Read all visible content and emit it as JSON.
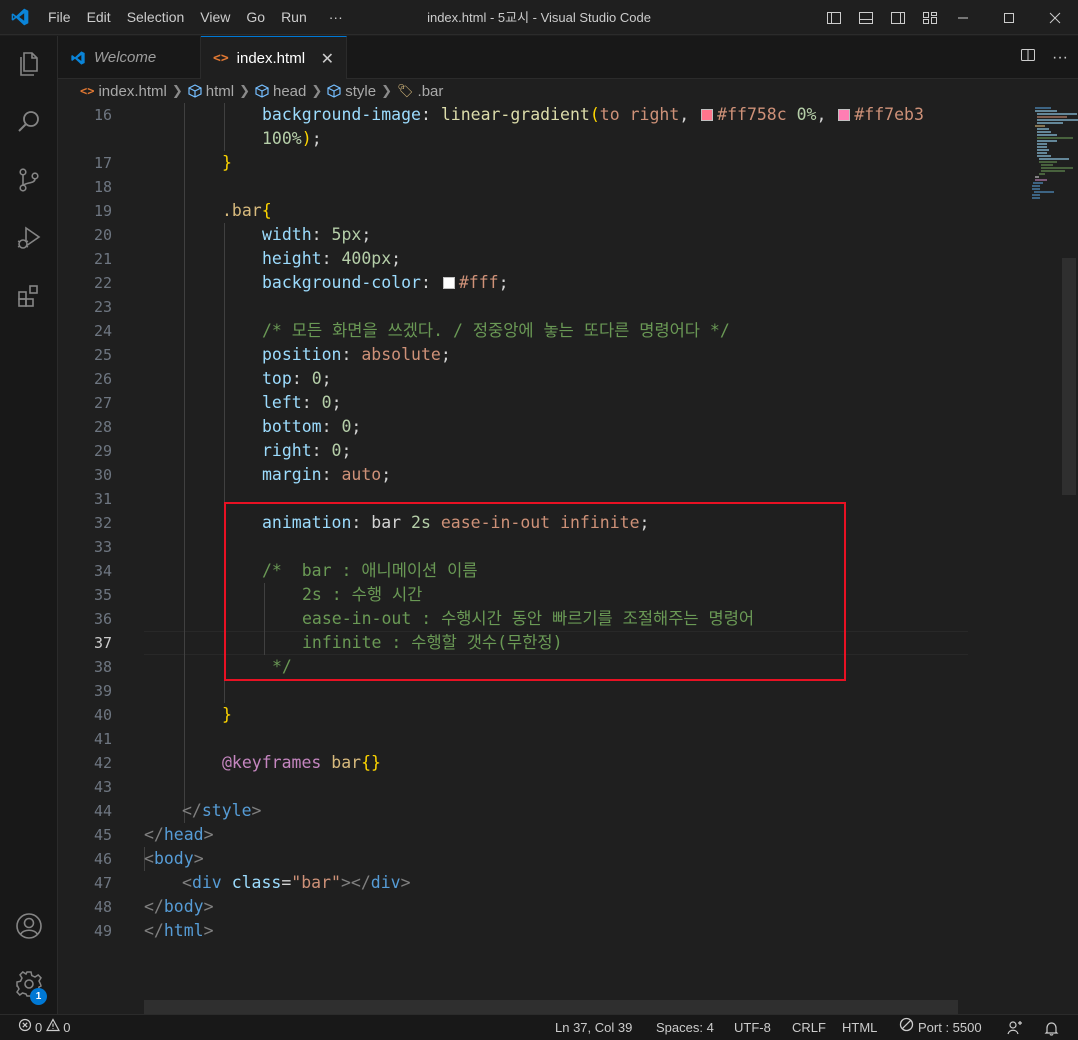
{
  "window": {
    "title": "index.html - 5교시 - Visual Studio Code",
    "menu": [
      "File",
      "Edit",
      "Selection",
      "View",
      "Go",
      "Run",
      "···"
    ]
  },
  "tabs": [
    {
      "label": "Welcome"
    },
    {
      "label": "index.html",
      "close": "✕"
    }
  ],
  "breadcrumb": [
    "index.html",
    "html",
    "head",
    "style",
    ".bar"
  ],
  "colors": {
    "accent": "#0078d4",
    "highlight_box": "#e81123",
    "swatch_1": "#ff758c",
    "swatch_2": "#ff7eb3",
    "swatch_3": "#ffffff"
  },
  "icons": {
    "activity": [
      "explorer-icon",
      "search-icon",
      "source-control-icon",
      "run-debug-icon",
      "extensions-icon",
      "account-icon",
      "settings-gear-icon"
    ],
    "settings_badge": "1"
  },
  "editor": {
    "current_line": "37",
    "lines": [
      {
        "n": "16",
        "t": "background-image: linear-gradient(to right, #ff758c 0%, #ff7eb3"
      },
      {
        "n": "",
        "t": "100%);"
      },
      {
        "n": "17",
        "t": "}"
      },
      {
        "n": "18",
        "t": ""
      },
      {
        "n": "19",
        "t": ".bar{"
      },
      {
        "n": "20",
        "t": "width: 5px;"
      },
      {
        "n": "21",
        "t": "height: 400px;"
      },
      {
        "n": "22",
        "t": "background-color: #fff;"
      },
      {
        "n": "23",
        "t": ""
      },
      {
        "n": "24",
        "t": "/* 모든 화면을 쓰겠다. / 정중앙에 놓는 또다른 명령어다 */"
      },
      {
        "n": "25",
        "t": "position: absolute;"
      },
      {
        "n": "26",
        "t": "top: 0;"
      },
      {
        "n": "27",
        "t": "left: 0;"
      },
      {
        "n": "28",
        "t": "bottom: 0;"
      },
      {
        "n": "29",
        "t": "right: 0;"
      },
      {
        "n": "30",
        "t": "margin: auto;"
      },
      {
        "n": "31",
        "t": ""
      },
      {
        "n": "32",
        "t": "animation: bar 2s ease-in-out infinite;"
      },
      {
        "n": "33",
        "t": ""
      },
      {
        "n": "34",
        "t": "/*  bar : 애니메이션 이름"
      },
      {
        "n": "35",
        "t": "2s : 수행 시간"
      },
      {
        "n": "36",
        "t": "ease-in-out : 수행시간 동안 빠르기를 조절해주는 명령어"
      },
      {
        "n": "37",
        "t": "infinite : 수행할 갯수(무한정)"
      },
      {
        "n": "38",
        "t": "*/"
      },
      {
        "n": "39",
        "t": ""
      },
      {
        "n": "40",
        "t": "}"
      },
      {
        "n": "41",
        "t": ""
      },
      {
        "n": "42",
        "t": "@keyframes bar{}"
      },
      {
        "n": "43",
        "t": ""
      },
      {
        "n": "44",
        "t": "</style>"
      },
      {
        "n": "45",
        "t": "</head>"
      },
      {
        "n": "46",
        "t": "<body>"
      },
      {
        "n": "47",
        "t": "<div class=\"bar\"></div>"
      },
      {
        "n": "48",
        "t": "</body>"
      },
      {
        "n": "49",
        "t": "</html>"
      }
    ]
  },
  "status": {
    "errors": "0",
    "warnings": "0",
    "position": "Ln 37, Col 39",
    "spaces": "Spaces: 4",
    "encoding": "UTF-8",
    "eol": "CRLF",
    "language": "HTML",
    "port": "Port : 5500"
  }
}
